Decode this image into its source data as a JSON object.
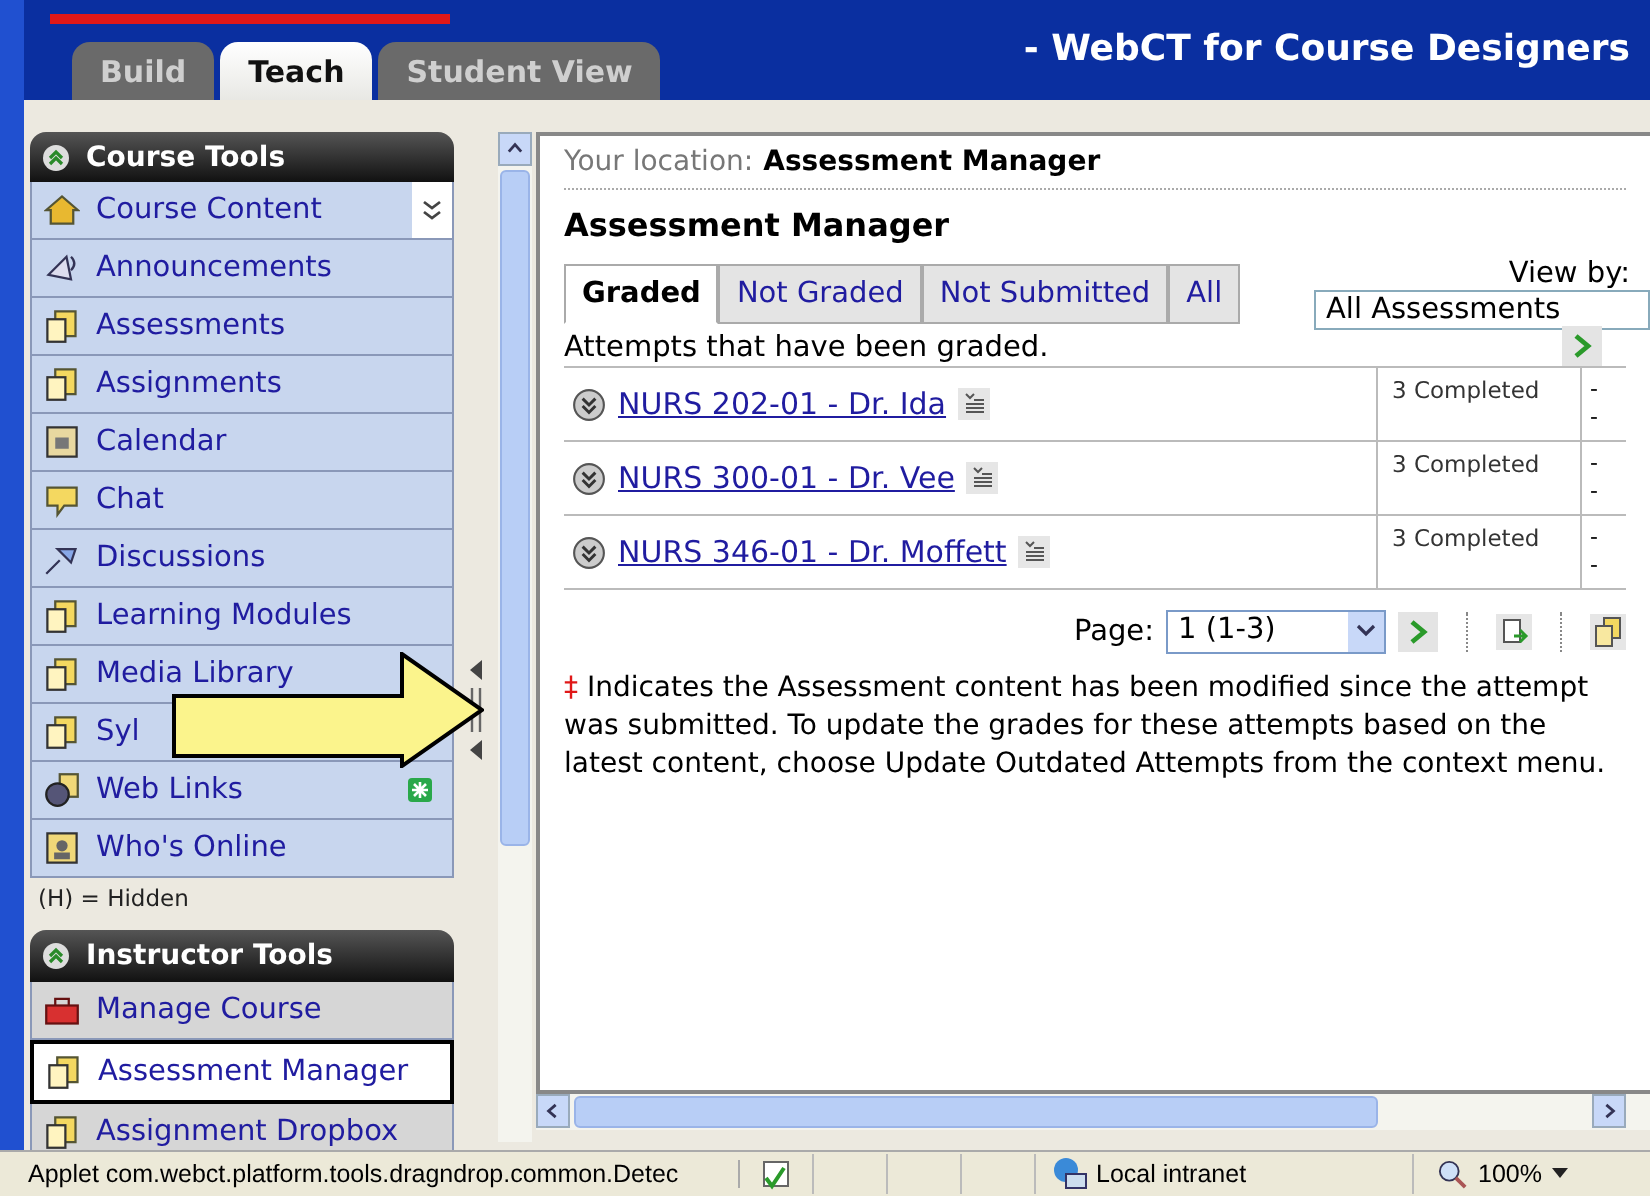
{
  "header": {
    "tabs": [
      {
        "label": "Build",
        "selected": false
      },
      {
        "label": "Teach",
        "selected": true
      },
      {
        "label": "Student View",
        "selected": false
      }
    ],
    "title": "- WebCT for Course Designers"
  },
  "course_tools": {
    "title": "Course Tools",
    "items": [
      {
        "label": "Course Content",
        "selected": false,
        "new": false,
        "menu": true
      },
      {
        "label": "Announcements",
        "selected": false,
        "new": false,
        "menu": false
      },
      {
        "label": "Assessments",
        "selected": false,
        "new": false,
        "menu": false
      },
      {
        "label": "Assignments",
        "selected": false,
        "new": false,
        "menu": false
      },
      {
        "label": "Calendar",
        "selected": false,
        "new": false,
        "menu": false
      },
      {
        "label": "Chat",
        "selected": false,
        "new": false,
        "menu": false
      },
      {
        "label": "Discussions",
        "selected": false,
        "new": false,
        "menu": false
      },
      {
        "label": "Learning Modules",
        "selected": false,
        "new": false,
        "menu": false
      },
      {
        "label": "Media Library",
        "selected": false,
        "new": false,
        "menu": false
      },
      {
        "label": "Syl",
        "selected": false,
        "new": false,
        "menu": false
      },
      {
        "label": "Web Links",
        "selected": false,
        "new": true,
        "menu": false
      },
      {
        "label": "Who's Online",
        "selected": false,
        "new": false,
        "menu": false
      }
    ],
    "legend": "(H) = Hidden"
  },
  "instructor_tools": {
    "title": "Instructor Tools",
    "items": [
      {
        "label": "Manage Course",
        "selected": false
      },
      {
        "label": "Assessment Manager",
        "selected": true
      },
      {
        "label": "Assignment Dropbox",
        "selected": false
      }
    ]
  },
  "content": {
    "location_label": "Your location:",
    "location": "Assessment Manager",
    "heading": "Assessment Manager",
    "tabs": [
      {
        "label": "Graded",
        "selected": true
      },
      {
        "label": "Not Graded",
        "selected": false
      },
      {
        "label": "Not Submitted",
        "selected": false
      },
      {
        "label": "All",
        "selected": false
      }
    ],
    "view_by": {
      "label": "View by:",
      "value": "All Assessments"
    },
    "description": "Attempts that have been graded.",
    "rows": [
      {
        "title": "NURS 202-01 - Dr. Ida",
        "status": "3 Completed",
        "column_3": [
          "-",
          "-"
        ]
      },
      {
        "title": "NURS 300-01 - Dr. Vee",
        "status": "3 Completed",
        "column_3": [
          "-",
          "-"
        ]
      },
      {
        "title": "NURS 346-01 - Dr. Moffett",
        "status": "3 Completed",
        "column_3": [
          "-",
          "-"
        ]
      }
    ],
    "pager": {
      "label": "Page:",
      "value": "1 (1-3)"
    },
    "note_mark": "‡",
    "note": "Indicates the Assessment content has been modified since the attempt was submitted. To update the grades for these attempts based on the latest content, choose Update Outdated Attempts from the context menu."
  },
  "status_bar": {
    "text": "Applet com.webct.platform.tools.dragndrop.common.Detec",
    "zone": "Local intranet",
    "zoom": "100%"
  }
}
